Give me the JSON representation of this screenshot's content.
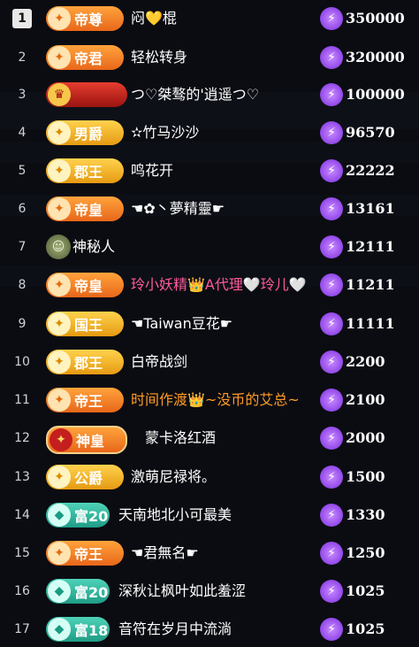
{
  "rows": [
    {
      "rank": "1",
      "badge": "帝尊",
      "tier": "orange",
      "name": "闷💛棍",
      "color": "white",
      "amount": "350000"
    },
    {
      "rank": "2",
      "badge": "帝君",
      "tier": "orange",
      "name": "轻松转身",
      "color": "white",
      "amount": "320000"
    },
    {
      "rank": "3",
      "badge": "",
      "tier": "red",
      "name": "つ♡桀骜的'逍遥つ♡",
      "color": "white",
      "amount": "100000"
    },
    {
      "rank": "4",
      "badge": "男爵",
      "tier": "gold",
      "name": "✫竹马沙沙",
      "color": "white",
      "amount": "96570"
    },
    {
      "rank": "5",
      "badge": "郡王",
      "tier": "gold",
      "name": "鸣花开",
      "color": "white",
      "amount": "22222"
    },
    {
      "rank": "6",
      "badge": "帝皇",
      "tier": "orange",
      "name": "☚✿丶夢精靈☛",
      "color": "white",
      "amount": "13161"
    },
    {
      "rank": "7",
      "badge": "",
      "tier": "avatar",
      "name": "神秘人",
      "color": "white",
      "amount": "12111"
    },
    {
      "rank": "8",
      "badge": "帝皇",
      "tier": "orange",
      "name": "玲小妖精👑A代理🤍玲儿🤍",
      "color": "pink",
      "amount": "11211"
    },
    {
      "rank": "9",
      "badge": "国王",
      "tier": "gold",
      "name": "☚Taiwan豆花☛",
      "color": "white",
      "amount": "11111"
    },
    {
      "rank": "10",
      "badge": "郡王",
      "tier": "gold",
      "name": "白帝战剑",
      "color": "white",
      "amount": "2200"
    },
    {
      "rank": "11",
      "badge": "帝王",
      "tier": "orange",
      "name": "时间作渡👑~没币的艾总~",
      "color": "orange",
      "amount": "2100"
    },
    {
      "rank": "12",
      "badge": "神皇",
      "tier": "crown",
      "name": "蒙卡洛红酒",
      "color": "white",
      "amount": "2000"
    },
    {
      "rank": "13",
      "badge": "公爵",
      "tier": "gold",
      "name": "激萌尼禄将。",
      "color": "white",
      "amount": "1500"
    },
    {
      "rank": "14",
      "badge": "富20",
      "tier": "green",
      "name": "天南地北小可最美",
      "color": "white",
      "amount": "1330"
    },
    {
      "rank": "15",
      "badge": "帝王",
      "tier": "orange",
      "name": "☚君無名☛",
      "color": "white",
      "amount": "1250"
    },
    {
      "rank": "16",
      "badge": "富20",
      "tier": "green",
      "name": "深秋让枫叶如此羞涩",
      "color": "white",
      "amount": "1025"
    },
    {
      "rank": "17",
      "badge": "富18",
      "tier": "green",
      "name": "音符在岁月中流淌",
      "color": "white",
      "amount": "1025"
    }
  ],
  "colors": {
    "bolt": "#8a3df0",
    "orange_name": "#ff9b24",
    "pink_name": "#ff5a9d"
  },
  "icons": {
    "bolt": "lightning-bolt-icon",
    "emblem": "rank-emblem-icon"
  }
}
